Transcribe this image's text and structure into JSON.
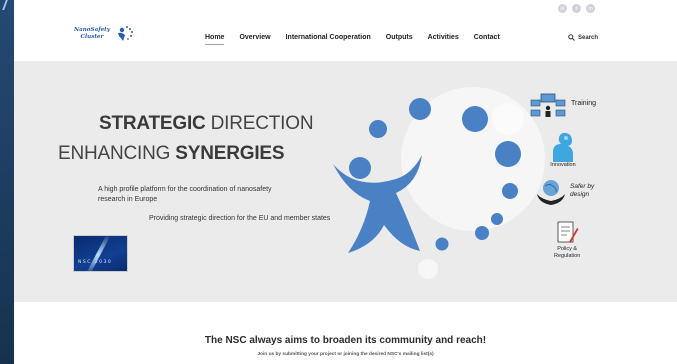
{
  "header": {
    "logo_line1": "NanoSafety",
    "logo_line2": "Cluster",
    "nav": [
      {
        "label": "Home",
        "active": true
      },
      {
        "label": "Overview",
        "active": false
      },
      {
        "label": "International Cooperation",
        "active": false
      },
      {
        "label": "Outputs",
        "active": false
      },
      {
        "label": "Activities",
        "active": false
      },
      {
        "label": "Contact",
        "active": false
      }
    ],
    "search_label": "Search",
    "social_icons": [
      "email-icon",
      "twitter-icon",
      "linkedin-icon"
    ]
  },
  "hero": {
    "line1_bold": "STRATEGIC",
    "line1_light": " DIRECTION",
    "line2_light": "ENHANCING ",
    "line2_bold": "SYNERGIES",
    "desc1": "A high profile platform for the coordination of nanosafety research in Europe",
    "desc2": "Providing strategic direction for the EU and member states",
    "eu_badge_text": "NSC 2030"
  },
  "side": {
    "training": "Training",
    "innovation": "Innovation",
    "safer_line1": "Safer by",
    "safer_line2": "design",
    "policy_line1": "Policy &",
    "policy_line2": "Regulation"
  },
  "cta": {
    "title": "The NSC always aims to broaden its community and reach!",
    "subtitle": "Join us by submitting your project or joining the desired NSC's mailing list(s)"
  },
  "colors": {
    "brand_blue": "#4a80c4",
    "hero_bg": "#ebebeb",
    "frame_dark": "#1f3b5c"
  }
}
